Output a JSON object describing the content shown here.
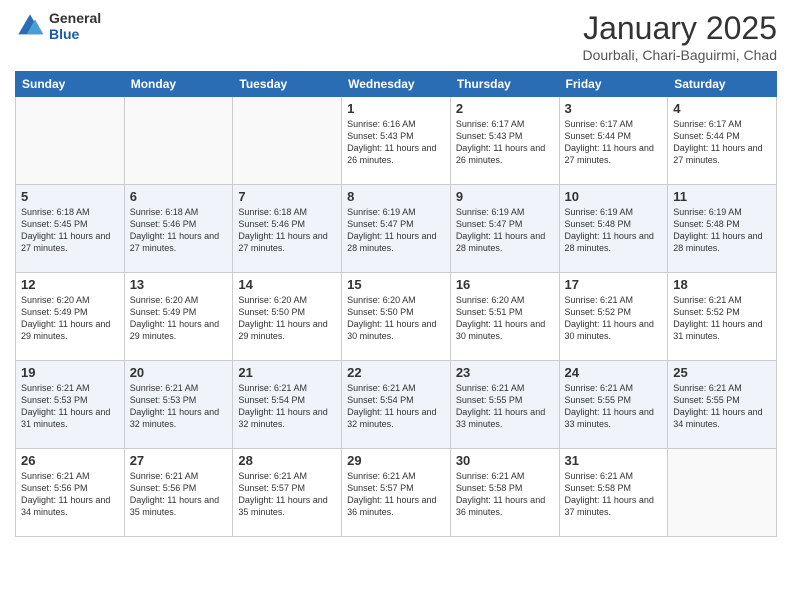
{
  "logo": {
    "general": "General",
    "blue": "Blue"
  },
  "header": {
    "month": "January 2025",
    "location": "Dourbali, Chari-Baguirmi, Chad"
  },
  "weekdays": [
    "Sunday",
    "Monday",
    "Tuesday",
    "Wednesday",
    "Thursday",
    "Friday",
    "Saturday"
  ],
  "weeks": [
    [
      {
        "day": "",
        "info": ""
      },
      {
        "day": "",
        "info": ""
      },
      {
        "day": "",
        "info": ""
      },
      {
        "day": "1",
        "info": "Sunrise: 6:16 AM\nSunset: 5:43 PM\nDaylight: 11 hours and 26 minutes."
      },
      {
        "day": "2",
        "info": "Sunrise: 6:17 AM\nSunset: 5:43 PM\nDaylight: 11 hours and 26 minutes."
      },
      {
        "day": "3",
        "info": "Sunrise: 6:17 AM\nSunset: 5:44 PM\nDaylight: 11 hours and 27 minutes."
      },
      {
        "day": "4",
        "info": "Sunrise: 6:17 AM\nSunset: 5:44 PM\nDaylight: 11 hours and 27 minutes."
      }
    ],
    [
      {
        "day": "5",
        "info": "Sunrise: 6:18 AM\nSunset: 5:45 PM\nDaylight: 11 hours and 27 minutes."
      },
      {
        "day": "6",
        "info": "Sunrise: 6:18 AM\nSunset: 5:46 PM\nDaylight: 11 hours and 27 minutes."
      },
      {
        "day": "7",
        "info": "Sunrise: 6:18 AM\nSunset: 5:46 PM\nDaylight: 11 hours and 27 minutes."
      },
      {
        "day": "8",
        "info": "Sunrise: 6:19 AM\nSunset: 5:47 PM\nDaylight: 11 hours and 28 minutes."
      },
      {
        "day": "9",
        "info": "Sunrise: 6:19 AM\nSunset: 5:47 PM\nDaylight: 11 hours and 28 minutes."
      },
      {
        "day": "10",
        "info": "Sunrise: 6:19 AM\nSunset: 5:48 PM\nDaylight: 11 hours and 28 minutes."
      },
      {
        "day": "11",
        "info": "Sunrise: 6:19 AM\nSunset: 5:48 PM\nDaylight: 11 hours and 28 minutes."
      }
    ],
    [
      {
        "day": "12",
        "info": "Sunrise: 6:20 AM\nSunset: 5:49 PM\nDaylight: 11 hours and 29 minutes."
      },
      {
        "day": "13",
        "info": "Sunrise: 6:20 AM\nSunset: 5:49 PM\nDaylight: 11 hours and 29 minutes."
      },
      {
        "day": "14",
        "info": "Sunrise: 6:20 AM\nSunset: 5:50 PM\nDaylight: 11 hours and 29 minutes."
      },
      {
        "day": "15",
        "info": "Sunrise: 6:20 AM\nSunset: 5:50 PM\nDaylight: 11 hours and 30 minutes."
      },
      {
        "day": "16",
        "info": "Sunrise: 6:20 AM\nSunset: 5:51 PM\nDaylight: 11 hours and 30 minutes."
      },
      {
        "day": "17",
        "info": "Sunrise: 6:21 AM\nSunset: 5:52 PM\nDaylight: 11 hours and 30 minutes."
      },
      {
        "day": "18",
        "info": "Sunrise: 6:21 AM\nSunset: 5:52 PM\nDaylight: 11 hours and 31 minutes."
      }
    ],
    [
      {
        "day": "19",
        "info": "Sunrise: 6:21 AM\nSunset: 5:53 PM\nDaylight: 11 hours and 31 minutes."
      },
      {
        "day": "20",
        "info": "Sunrise: 6:21 AM\nSunset: 5:53 PM\nDaylight: 11 hours and 32 minutes."
      },
      {
        "day": "21",
        "info": "Sunrise: 6:21 AM\nSunset: 5:54 PM\nDaylight: 11 hours and 32 minutes."
      },
      {
        "day": "22",
        "info": "Sunrise: 6:21 AM\nSunset: 5:54 PM\nDaylight: 11 hours and 32 minutes."
      },
      {
        "day": "23",
        "info": "Sunrise: 6:21 AM\nSunset: 5:55 PM\nDaylight: 11 hours and 33 minutes."
      },
      {
        "day": "24",
        "info": "Sunrise: 6:21 AM\nSunset: 5:55 PM\nDaylight: 11 hours and 33 minutes."
      },
      {
        "day": "25",
        "info": "Sunrise: 6:21 AM\nSunset: 5:55 PM\nDaylight: 11 hours and 34 minutes."
      }
    ],
    [
      {
        "day": "26",
        "info": "Sunrise: 6:21 AM\nSunset: 5:56 PM\nDaylight: 11 hours and 34 minutes."
      },
      {
        "day": "27",
        "info": "Sunrise: 6:21 AM\nSunset: 5:56 PM\nDaylight: 11 hours and 35 minutes."
      },
      {
        "day": "28",
        "info": "Sunrise: 6:21 AM\nSunset: 5:57 PM\nDaylight: 11 hours and 35 minutes."
      },
      {
        "day": "29",
        "info": "Sunrise: 6:21 AM\nSunset: 5:57 PM\nDaylight: 11 hours and 36 minutes."
      },
      {
        "day": "30",
        "info": "Sunrise: 6:21 AM\nSunset: 5:58 PM\nDaylight: 11 hours and 36 minutes."
      },
      {
        "day": "31",
        "info": "Sunrise: 6:21 AM\nSunset: 5:58 PM\nDaylight: 11 hours and 37 minutes."
      },
      {
        "day": "",
        "info": ""
      }
    ]
  ]
}
